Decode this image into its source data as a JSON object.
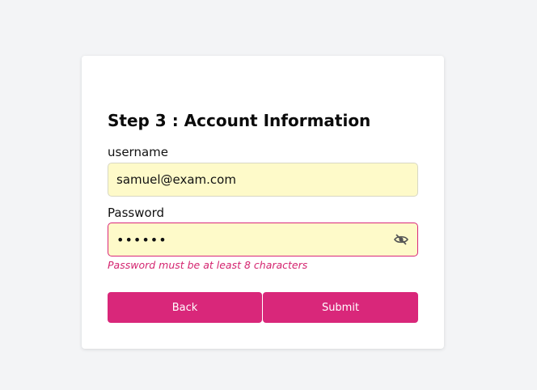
{
  "form": {
    "title": "Step 3 : Account Information",
    "username": {
      "label": "username",
      "value": "samuel@exam.com"
    },
    "password": {
      "label": "Password",
      "value": "samuel",
      "toggle_icon": "eye-slash-icon",
      "error": "Password must be at least 8 characters"
    },
    "buttons": {
      "back_label": "Back",
      "submit_label": "Submit"
    }
  },
  "colors": {
    "background": "#f3f4f6",
    "card": "#ffffff",
    "input_fill": "#fefac9",
    "accent": "#d9277a",
    "error_text": "#d4246f"
  }
}
